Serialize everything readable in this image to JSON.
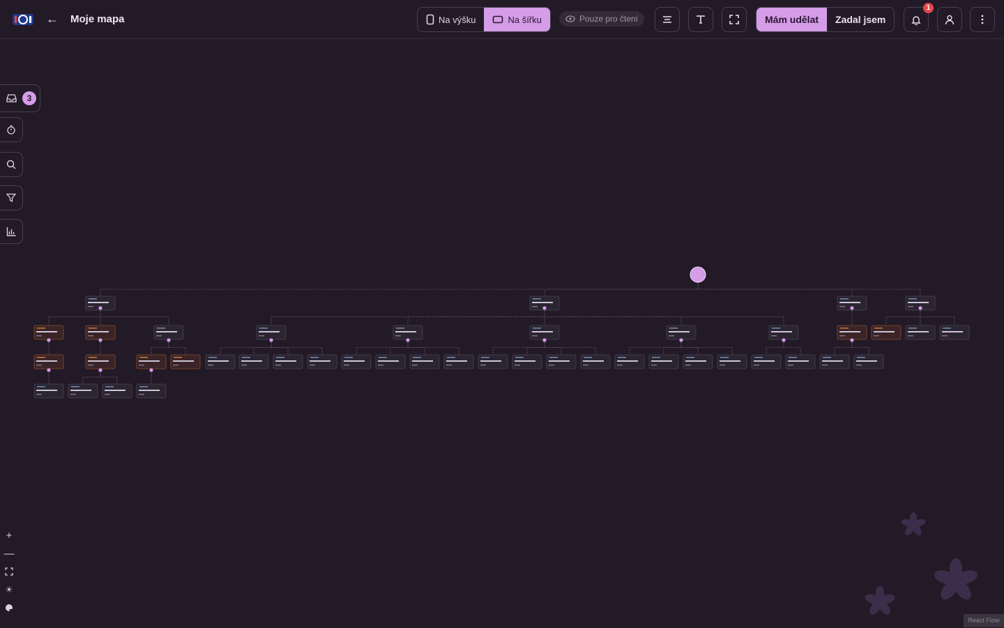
{
  "header": {
    "back_icon": "arrow-left-icon",
    "title": "Moje mapa",
    "orientation": {
      "portrait": "Na výšku",
      "landscape": "Na šířku",
      "selected": "Na šířku"
    },
    "readonly": "Pouze pro čtení",
    "roles": {
      "assigned_to_me": "Mám udělat",
      "assigned_by_me": "Zadal jsem",
      "selected": "Mám udělat"
    },
    "notifications_count": "1"
  },
  "sidebar": {
    "inbox_count": "3",
    "items": [
      {
        "icon": "inbox-icon"
      },
      {
        "icon": "timer-icon"
      },
      {
        "icon": "search-icon"
      },
      {
        "icon": "filter-icon"
      },
      {
        "icon": "bar-chart-icon"
      }
    ]
  },
  "zoom_controls": [
    "plus-icon",
    "minus-icon",
    "fit-view-icon",
    "sun-icon",
    "palette-icon"
  ],
  "attribution": "React Flow",
  "colors": {
    "accent": "#d59ce8",
    "background": "#221a26",
    "badge": "#e5484d"
  }
}
